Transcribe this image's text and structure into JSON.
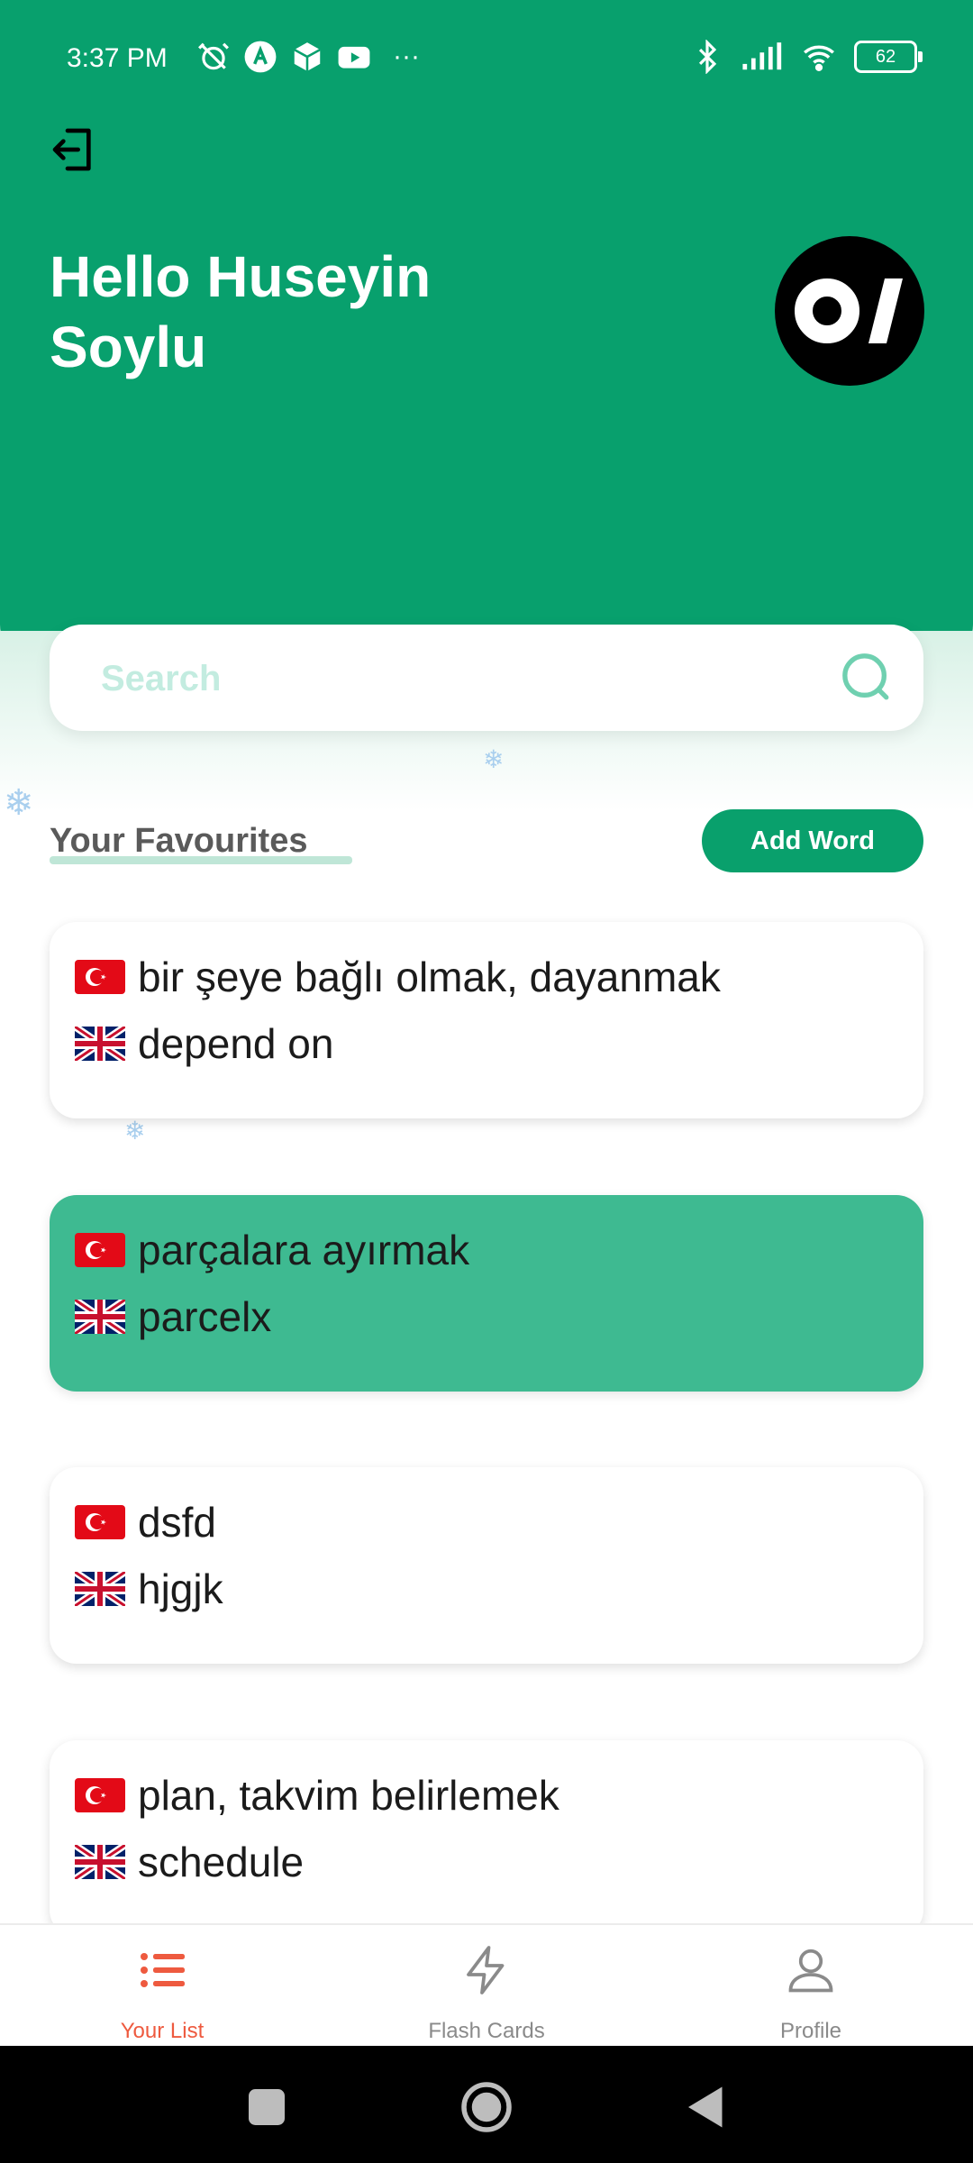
{
  "status_bar": {
    "time": "3:37 PM",
    "more": "···",
    "battery": "62"
  },
  "header": {
    "greeting": "Hello Huseyin Soylu"
  },
  "search": {
    "placeholder": "Search"
  },
  "favourites": {
    "title": "Your Favourites",
    "add_button": "Add Word"
  },
  "words": [
    {
      "tr": "bir şeye bağlı olmak, dayanmak",
      "en": "depend on",
      "highlighted": false
    },
    {
      "tr": "parçalara ayırmak",
      "en": "parcelx",
      "highlighted": true
    },
    {
      "tr": "dsfd",
      "en": "hjgjk",
      "highlighted": false
    },
    {
      "tr": "plan, takvim belirlemek",
      "en": "schedule",
      "highlighted": false
    }
  ],
  "nav": {
    "items": [
      {
        "label": "Your List",
        "icon": "list-icon",
        "active": true
      },
      {
        "label": "Flash Cards",
        "icon": "lightning-icon",
        "active": false
      },
      {
        "label": "Profile",
        "icon": "user-icon",
        "active": false
      }
    ]
  },
  "colors": {
    "primary": "#08a06d",
    "card_highlight": "#3eba91",
    "nav_active": "#ee5a3f"
  }
}
